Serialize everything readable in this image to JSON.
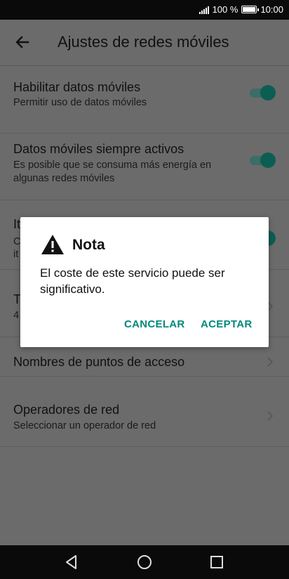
{
  "status_bar": {
    "battery_text": "100 %",
    "time": "10:00"
  },
  "app_bar": {
    "title": "Ajustes de redes móviles",
    "back_icon": "arrow-left-icon"
  },
  "settings": [
    {
      "title": "Habilitar datos móviles",
      "subtitle": "Permitir uso de datos móviles",
      "control": "toggle",
      "on": true
    },
    {
      "title": "Datos móviles siempre activos",
      "subtitle": "Es posible que se consuma más energía en algunas redes móviles",
      "control": "toggle",
      "on": true
    },
    {
      "title": "It",
      "subtitle_l1": "C",
      "subtitle_l2": "it",
      "control": "toggle",
      "on": true
    },
    {
      "title": "T",
      "subtitle": "4",
      "control": "chevron"
    },
    {
      "title": "Nombres de puntos de acceso",
      "control": "chevron"
    },
    {
      "title": "Operadores de red",
      "subtitle": "Seleccionar un operador de red",
      "control": "chevron"
    }
  ],
  "dialog": {
    "title": "Nota",
    "icon": "warning-icon",
    "body": "El coste de este servicio puede ser significativo.",
    "cancel_label": "CANCELAR",
    "accept_label": "ACEPTAR"
  },
  "colors": {
    "accent": "#00897b",
    "toggle_thumb": "#0c5e52"
  }
}
